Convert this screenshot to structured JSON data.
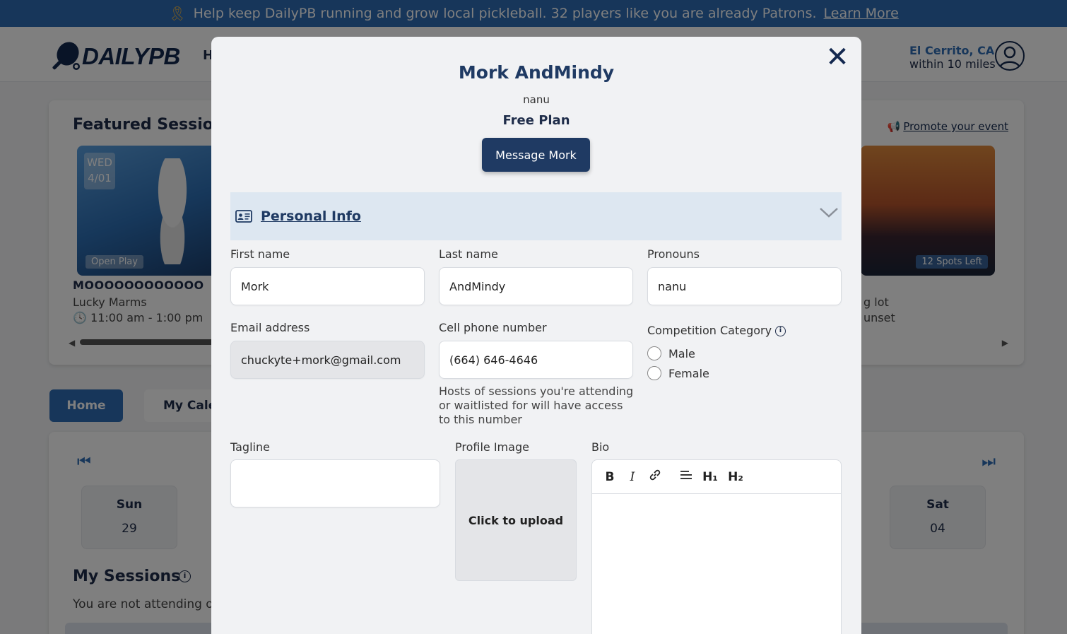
{
  "banner": {
    "ribbon_icon": "ribbon-icon",
    "message": "Help keep DailyPB running and grow local pickleball. 32 players like you are already Patrons.",
    "link": "Learn More"
  },
  "header": {
    "logo_text": "DAILYPB",
    "nav_home_partial": "H",
    "location_city": "El Cerrito, CA",
    "location_radius": "within 10 miles"
  },
  "background": {
    "featured_title": "Featured Sessions",
    "promote_link": "Promote your event",
    "session_left": {
      "day": "WED",
      "date": "4/01",
      "tag": "Open Play",
      "name": "MOOOOOOOOOOOO",
      "host": "Lucky Marms",
      "time": "11:00 am - 1:00 pm"
    },
    "session_right": {
      "spots": "12 Spots Left",
      "line1": "g lot",
      "line2": "unset"
    },
    "tabs": {
      "home": "Home",
      "calendar_partial": "My Cale"
    },
    "days": [
      {
        "name": "Sun",
        "num": "29"
      },
      {
        "name": "Sat",
        "num": "04"
      }
    ],
    "my_sessions_title": "My Sessions",
    "not_attending": "You are not attending or"
  },
  "modal": {
    "close_label": "✕",
    "name": "Mork AndMindy",
    "pronouns": "nanu",
    "plan": "Free Plan",
    "message_button": "Message Mork",
    "section_title": "Personal Info",
    "fields": {
      "first_name_label": "First name",
      "first_name_value": "Mork",
      "last_name_label": "Last name",
      "last_name_value": "AndMindy",
      "pronouns_label": "Pronouns",
      "pronouns_value": "nanu",
      "email_label": "Email address",
      "email_value": "chuckyte+mork@gmail.com",
      "phone_label": "Cell phone number",
      "phone_value": "(664) 646-4646",
      "phone_hint": "Hosts of sessions you're attending or waitlisted for will have access to this number",
      "competition_label": "Competition Category",
      "competition_options": [
        "Male",
        "Female"
      ],
      "tagline_label": "Tagline",
      "tagline_value": "",
      "profile_image_label": "Profile Image",
      "upload_text": "Click to upload",
      "bio_label": "Bio"
    },
    "toolbar": {
      "bold": "B",
      "italic": "I",
      "h1": "H₁",
      "h2": "H₂"
    }
  }
}
